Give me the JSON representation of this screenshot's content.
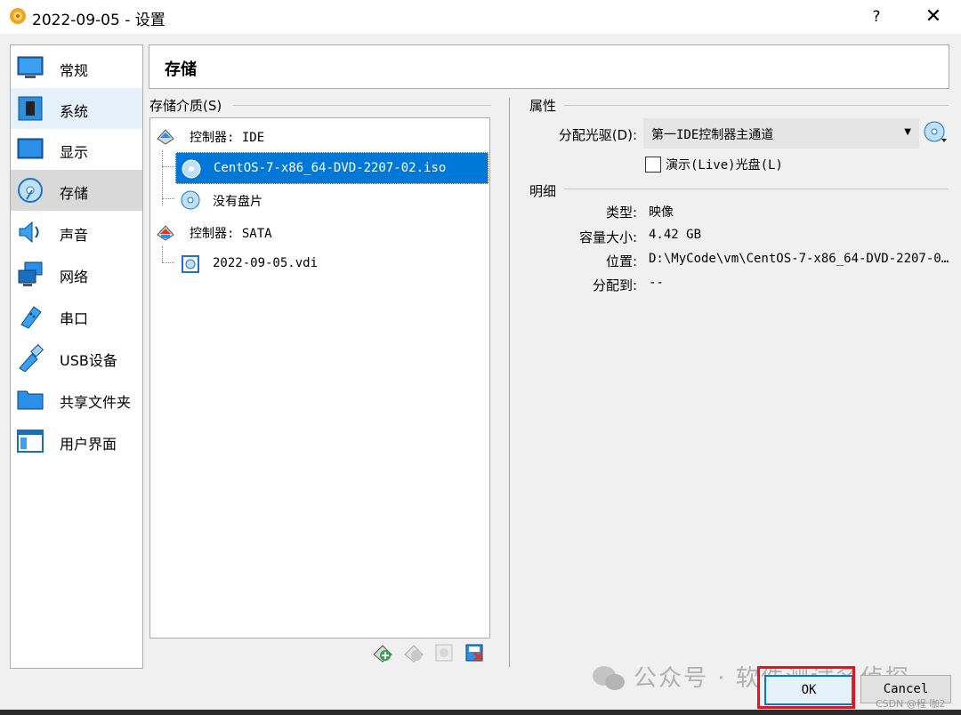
{
  "window": {
    "title": "2022-09-05 - 设置",
    "help_label": "?",
    "close_label": "✕"
  },
  "sidebar": {
    "items": [
      {
        "label": "常规",
        "icon": "monitor-icon"
      },
      {
        "label": "系统",
        "icon": "chip-icon"
      },
      {
        "label": "显示",
        "icon": "display-icon"
      },
      {
        "label": "存储",
        "icon": "storage-icon"
      },
      {
        "label": "声音",
        "icon": "speaker-icon"
      },
      {
        "label": "网络",
        "icon": "network-icon"
      },
      {
        "label": "串口",
        "icon": "serial-port-icon"
      },
      {
        "label": "USB设备",
        "icon": "usb-icon"
      },
      {
        "label": "共享文件夹",
        "icon": "folder-icon"
      },
      {
        "label": "用户界面",
        "icon": "window-icon"
      }
    ]
  },
  "header": {
    "title": "存储"
  },
  "storage": {
    "group_title": "存储介质(S)",
    "tree": [
      {
        "label": "控制器: IDE",
        "icon": "ide-controller-icon"
      },
      {
        "label": "CentOS-7-x86_64-DVD-2207-02.iso",
        "icon": "optical-disc-icon"
      },
      {
        "label": "没有盘片",
        "icon": "empty-disc-icon"
      },
      {
        "label": "控制器: SATA",
        "icon": "sata-controller-icon"
      },
      {
        "label": "2022-09-05.vdi",
        "icon": "hard-disk-icon"
      }
    ]
  },
  "attributes": {
    "group_title": "属性",
    "drive_label": "分配光驱(D):",
    "drive_value": "第一IDE控制器主通道",
    "live_cd_label": "演示(Live)光盘(L)"
  },
  "details": {
    "group_title": "明细",
    "type_label": "类型:",
    "type_value": "映像",
    "size_label": "容量大小:",
    "size_value": "4.42  GB",
    "location_label": "位置:",
    "location_value": "D:\\MyCode\\vm\\CentOS-7-x86_64-DVD-2207-0…",
    "attached_label": "分配到:",
    "attached_value": "--"
  },
  "buttons": {
    "ok": "OK",
    "cancel": "Cancel"
  },
  "watermark": {
    "text": "公众号 · 软件测试名侦探",
    "csdn": "CSDN @程 咖2"
  }
}
